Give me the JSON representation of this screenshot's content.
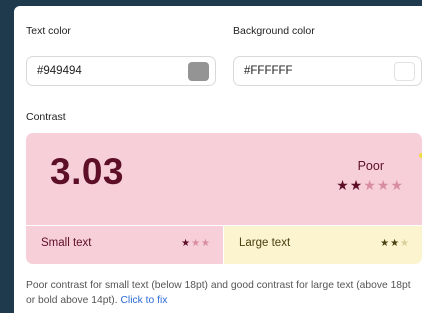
{
  "text_color": {
    "label": "Text color",
    "value": "#949494",
    "swatch": "#949494"
  },
  "background_color": {
    "label": "Background color",
    "value": "#FFFFFF",
    "swatch": "#FFFFFF"
  },
  "contrast": {
    "label": "Contrast",
    "ratio": "3.03",
    "rating": "Poor",
    "rating_stars": 2,
    "max_stars": 5,
    "colors": {
      "fail_bg": "#f7cfd9",
      "fail_text": "#5c0f26",
      "pass_bg": "#fbf4cf",
      "pass_text": "#4a4110"
    }
  },
  "small_text": {
    "label": "Small text",
    "stars": 1,
    "max_stars": 3
  },
  "large_text": {
    "label": "Large text",
    "stars": 2,
    "max_stars": 3
  },
  "description": {
    "text": "Poor contrast for small text (below 18pt) and good contrast for large text (above 18pt or bold above 14pt).",
    "link": "Click to fix"
  }
}
